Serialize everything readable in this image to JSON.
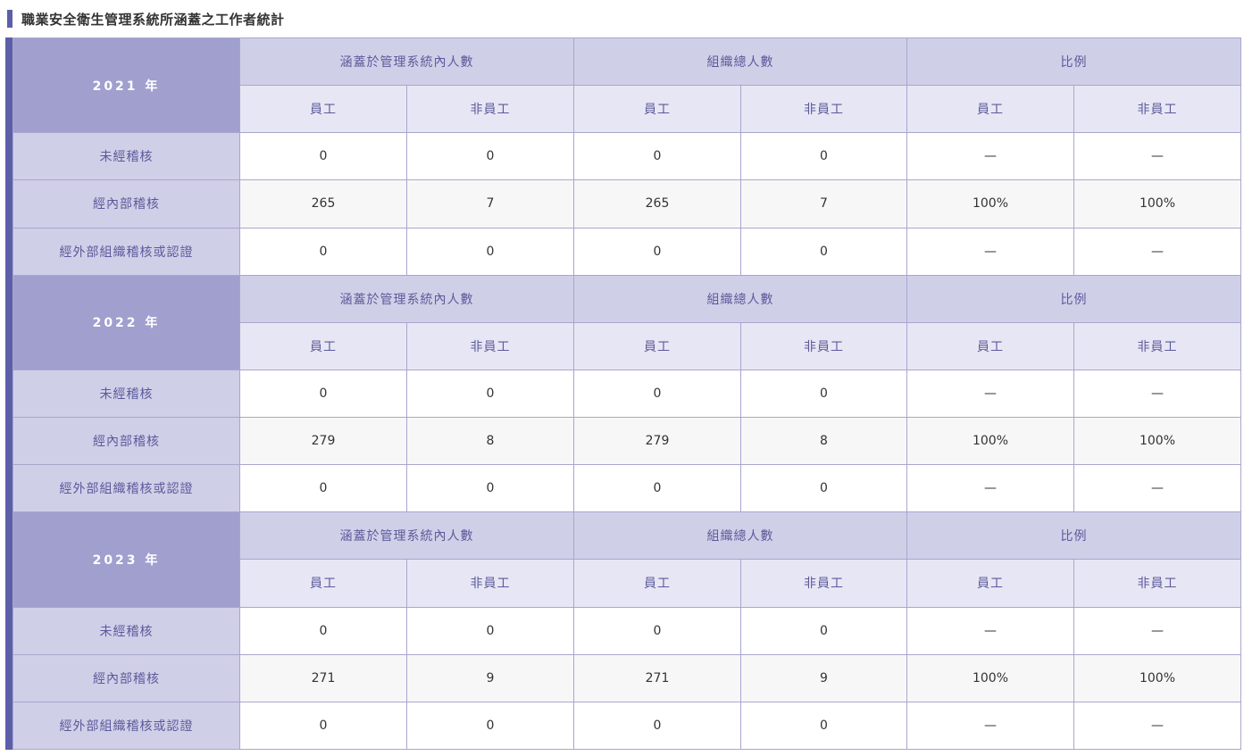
{
  "title": "職業安全衛生管理系統所涵蓋之工作者統計",
  "blocks": [
    {
      "year": "2021 年",
      "groups": [
        "涵蓋於管理系統內人數",
        "組織總人數",
        "比例"
      ],
      "subs": [
        "員工",
        "非員工",
        "員工",
        "非員工",
        "員工",
        "非員工"
      ],
      "rows": [
        {
          "label": "未經稽核",
          "values": [
            "0",
            "0",
            "0",
            "0",
            "—",
            "—"
          ]
        },
        {
          "label": "經內部稽核",
          "values": [
            "265",
            "7",
            "265",
            "7",
            "100%",
            "100%"
          ]
        },
        {
          "label": "經外部組織稽核或認證",
          "values": [
            "0",
            "0",
            "0",
            "0",
            "—",
            "—"
          ]
        }
      ]
    },
    {
      "year": "2022 年",
      "groups": [
        "涵蓋於管理系統內人數",
        "組織總人數",
        "比例"
      ],
      "subs": [
        "員工",
        "非員工",
        "員工",
        "非員工",
        "員工",
        "非員工"
      ],
      "rows": [
        {
          "label": "未經稽核",
          "values": [
            "0",
            "0",
            "0",
            "0",
            "—",
            "—"
          ]
        },
        {
          "label": "經內部稽核",
          "values": [
            "279",
            "8",
            "279",
            "8",
            "100%",
            "100%"
          ]
        },
        {
          "label": "經外部組織稽核或認證",
          "values": [
            "0",
            "0",
            "0",
            "0",
            "—",
            "—"
          ]
        }
      ]
    },
    {
      "year": "2023 年",
      "groups": [
        "涵蓋於管理系統內人數",
        "組織總人數",
        "比例"
      ],
      "subs": [
        "員工",
        "非員工",
        "員工",
        "非員工",
        "員工",
        "非員工"
      ],
      "rows": [
        {
          "label": "未經稽核",
          "values": [
            "0",
            "0",
            "0",
            "0",
            "—",
            "—"
          ]
        },
        {
          "label": "經內部稽核",
          "values": [
            "271",
            "9",
            "271",
            "9",
            "100%",
            "100%"
          ]
        },
        {
          "label": "經外部組織稽核或認證",
          "values": [
            "0",
            "0",
            "0",
            "0",
            "—",
            "—"
          ]
        }
      ]
    }
  ]
}
